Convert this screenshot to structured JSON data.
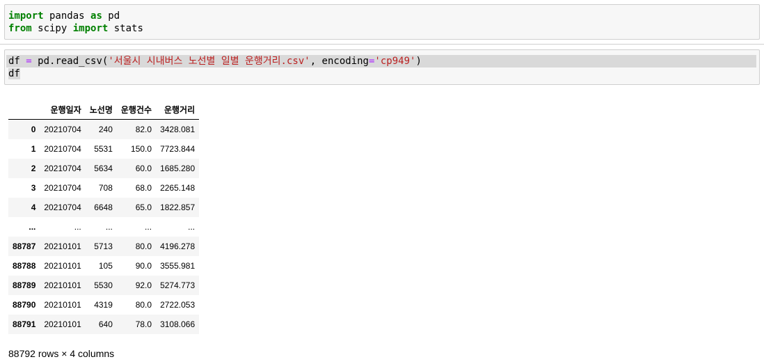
{
  "cell1": {
    "line1": {
      "kw1": "import",
      "t1": " pandas ",
      "kw2": "as",
      "t2": " pd"
    },
    "line2": {
      "kw1": "from",
      "t1": " scipy ",
      "kw2": "import",
      "t2": " stats"
    }
  },
  "cell2": {
    "line1": {
      "var": "df ",
      "eq": "=",
      "call": " pd.read_csv(",
      "arg1": "'서울시 시내버스 노선별 일별 운행거리.csv'",
      "sep": ", encoding",
      "eq2": "=",
      "arg2": "'cp949'",
      "close": ")"
    },
    "line2": "df"
  },
  "table": {
    "columns": [
      "",
      "운행일자",
      "노선명",
      "운행건수",
      "운행거리"
    ],
    "rows": [
      [
        "0",
        "20210704",
        "240",
        "82.0",
        "3428.081"
      ],
      [
        "1",
        "20210704",
        "5531",
        "150.0",
        "7723.844"
      ],
      [
        "2",
        "20210704",
        "5634",
        "60.0",
        "1685.280"
      ],
      [
        "3",
        "20210704",
        "708",
        "68.0",
        "2265.148"
      ],
      [
        "4",
        "20210704",
        "6648",
        "65.0",
        "1822.857"
      ],
      [
        "...",
        "...",
        "...",
        "...",
        "..."
      ],
      [
        "88787",
        "20210101",
        "5713",
        "80.0",
        "4196.278"
      ],
      [
        "88788",
        "20210101",
        "105",
        "90.0",
        "3555.981"
      ],
      [
        "88789",
        "20210101",
        "5530",
        "92.0",
        "5274.773"
      ],
      [
        "88790",
        "20210101",
        "4319",
        "80.0",
        "2722.053"
      ],
      [
        "88791",
        "20210101",
        "640",
        "78.0",
        "3108.066"
      ]
    ]
  },
  "footer": "88792 rows × 4 columns"
}
